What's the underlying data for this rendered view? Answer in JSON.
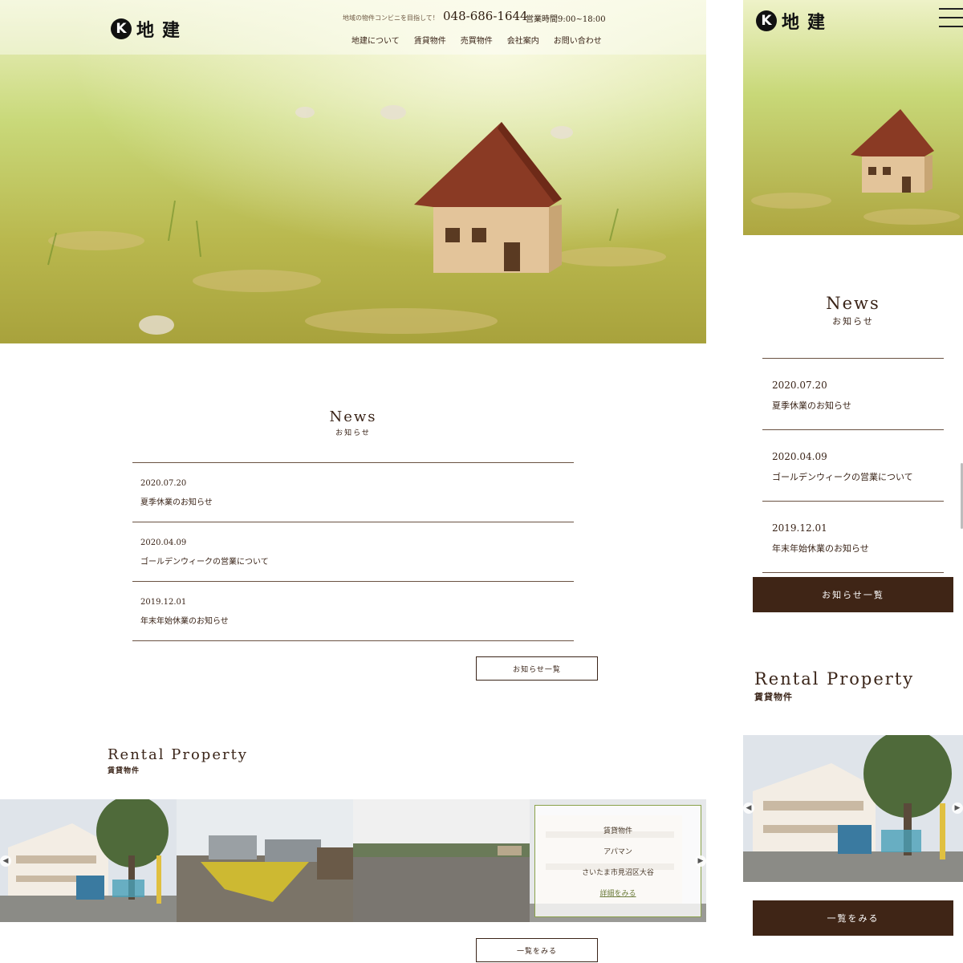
{
  "brand": {
    "logo_mark": "K",
    "logo_text": "地建"
  },
  "header": {
    "tagline": "地域の物件コンビニを目指して！",
    "phone": "048-686-1644",
    "hours": "営業時間9:00~18:00",
    "nav": [
      "地建について",
      "賃貸物件",
      "売買物件",
      "会社案内",
      "お問い合わせ"
    ]
  },
  "news": {
    "title_en": "News",
    "title_jp": "お知らせ",
    "items": [
      {
        "date": "2020.07.20",
        "title": "夏季休業のお知らせ"
      },
      {
        "date": "2020.04.09",
        "title": "ゴールデンウィークの営業について"
      },
      {
        "date": "2019.12.01",
        "title": "年末年始休業のお知らせ"
      }
    ],
    "more_label": "お知らせ一覧"
  },
  "rental": {
    "title_en": "Rental Property",
    "title_jp": "賃貸物件",
    "overlay": {
      "category": "賃貸物件",
      "type": "アパマン",
      "address": "さいたま市見沼区大谷",
      "details": "詳細をみる"
    },
    "more_label": "一覧をみる"
  },
  "icons": {
    "menu": "hamburger-icon",
    "prev": "chevron-left-icon",
    "next": "chevron-right-icon"
  },
  "colors": {
    "brand_brown": "#3f2516",
    "text": "#3a2418",
    "overlay_border": "#8aa24a"
  }
}
